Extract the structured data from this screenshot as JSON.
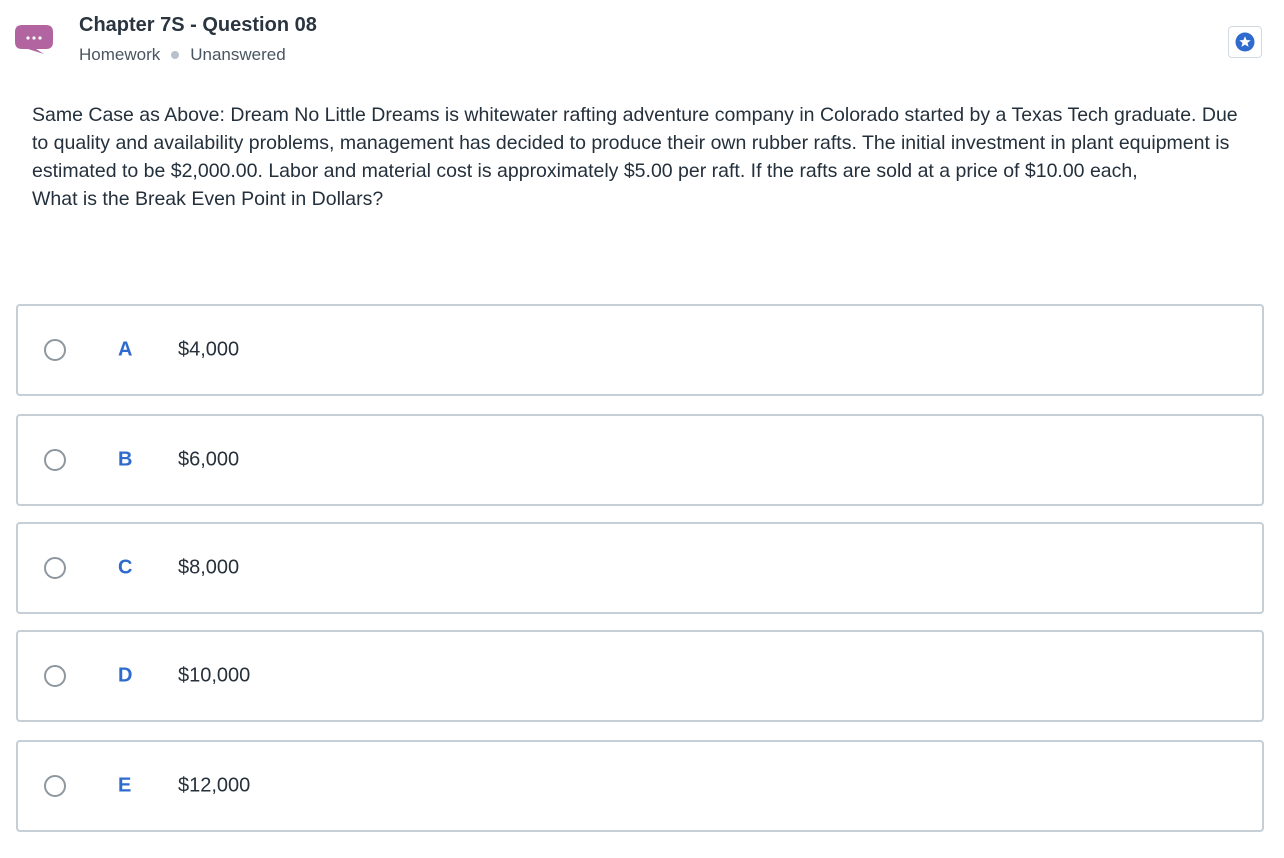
{
  "header": {
    "title": "Chapter 7S - Question 08",
    "category": "Homework",
    "status": "Unanswered",
    "chat_icon_color": "#b1649f",
    "star_icon_color": "#2f6bcf"
  },
  "question": {
    "body": "Same Case as Above: Dream No Little Dreams is whitewater rafting adventure company in Colorado started by a Texas Tech graduate. Due to quality and availability problems, management has decided to produce their own rubber rafts. The initial investment in plant equipment is estimated to be $2,000.00. Labor and material cost is approximately $5.00 per raft. If the rafts are sold at a price of $10.00 each,",
    "prompt": "What is the Break Even Point in Dollars?"
  },
  "options": [
    {
      "letter": "A",
      "text": "$4,000"
    },
    {
      "letter": "B",
      "text": "$6,000"
    },
    {
      "letter": "C",
      "text": "$8,000"
    },
    {
      "letter": "D",
      "text": "$10,000"
    },
    {
      "letter": "E",
      "text": "$12,000"
    }
  ]
}
